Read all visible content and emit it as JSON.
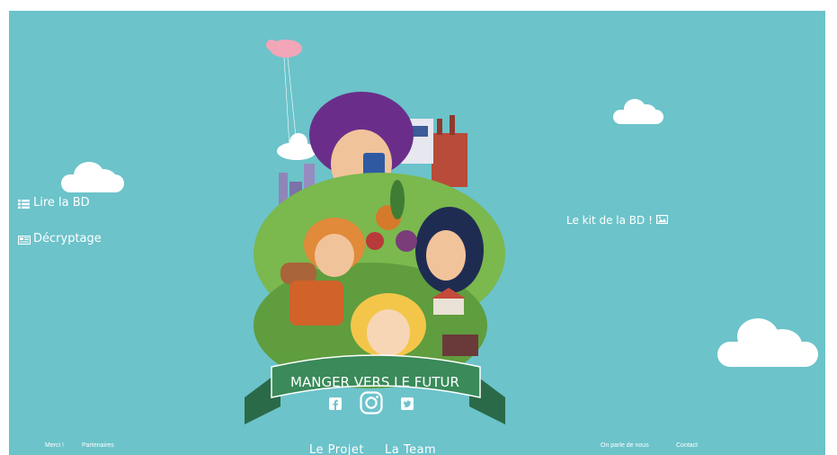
{
  "nav_left": {
    "read_label": "Lire la BD",
    "decode_label": "Décryptage"
  },
  "kit_link": {
    "label": "Le kit de la BD !"
  },
  "poster": {
    "banner_text": "MANGER VERS LE FUTUR"
  },
  "social": {
    "icons": [
      "facebook-icon",
      "instagram-icon",
      "twitter-icon"
    ]
  },
  "footer": {
    "merci": "Merci !",
    "partenaires": "Partenaires",
    "projet": "Le Projet",
    "team": "La Team",
    "press": "On parle de nous",
    "contact": "Contact"
  },
  "colors": {
    "background": "#6cc3ca",
    "banner": "#2f7a55",
    "text": "#ffffff"
  }
}
